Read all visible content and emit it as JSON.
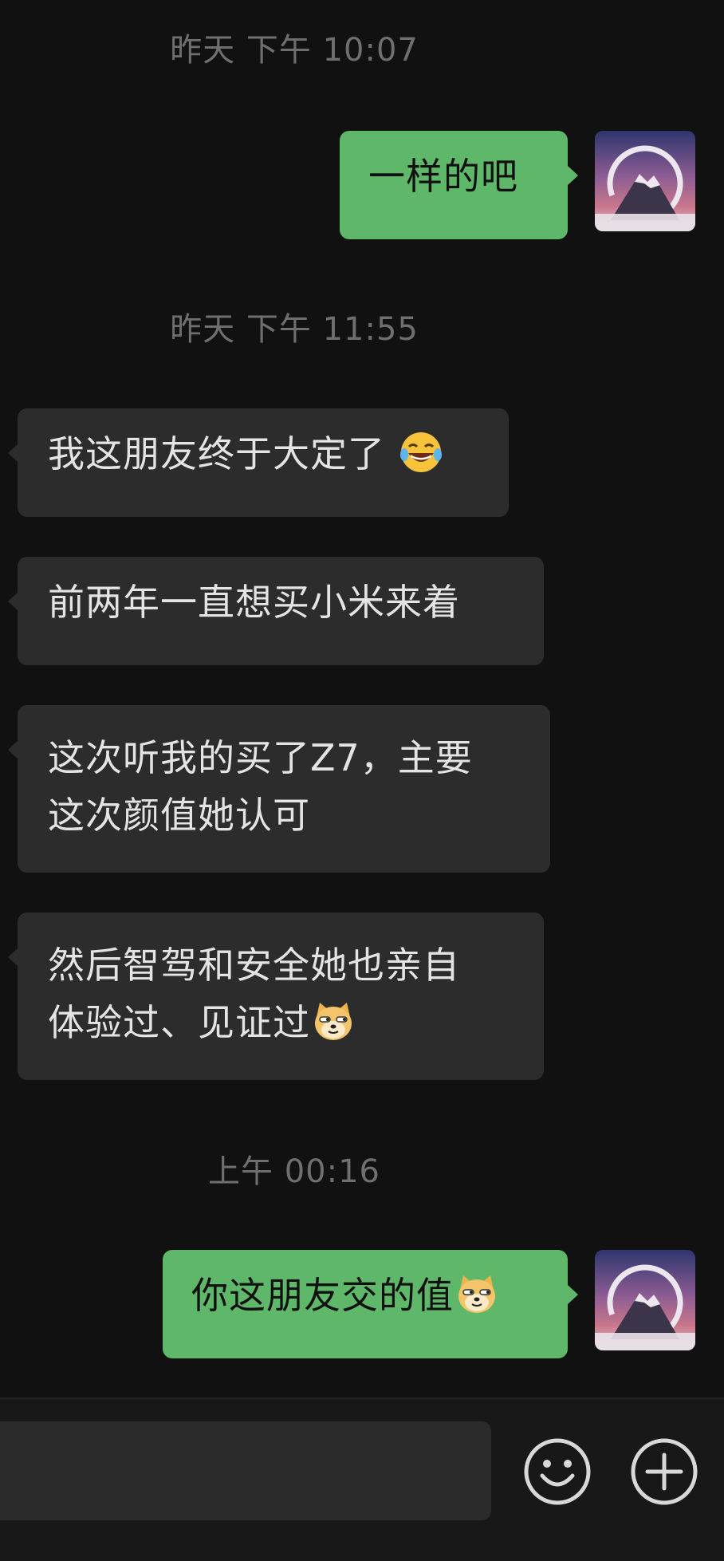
{
  "timestamps": [
    "昨天 下午 10:07",
    "昨天 下午 11:55",
    "上午 00:16"
  ],
  "messages": [
    {
      "direction": "outgoing",
      "text": "一样的吧"
    },
    {
      "direction": "incoming",
      "text": "我这朋友终于大定了",
      "emoji": "tears-of-joy-emoji"
    },
    {
      "direction": "incoming",
      "text": "前两年一直想买小米来着"
    },
    {
      "direction": "incoming",
      "line1": "这次听我的买了Z7，主要",
      "line2": "这次颜值她认可"
    },
    {
      "direction": "incoming",
      "line1": "然后智驾和安全她也亲自",
      "line2": "体验过、见证过",
      "emoji": "doge-emoji"
    },
    {
      "direction": "outgoing",
      "text": "你这朋友交的值",
      "emoji": "doge-emoji"
    }
  ],
  "avatar": {
    "icon": "mountain-avatar",
    "colors": {
      "top": "#3a3f7a",
      "mid": "#b56a8e",
      "low": "#c98a96"
    }
  },
  "input_bar": {
    "text_value": "",
    "emoji_icon": "smiley-face-icon",
    "plus_icon": "plus-circle-icon"
  },
  "colors": {
    "background": "#111111",
    "outgoing_bubble": "#5fb86a",
    "incoming_bubble": "#2c2c2c",
    "timestamp": "#6f6f6f"
  }
}
